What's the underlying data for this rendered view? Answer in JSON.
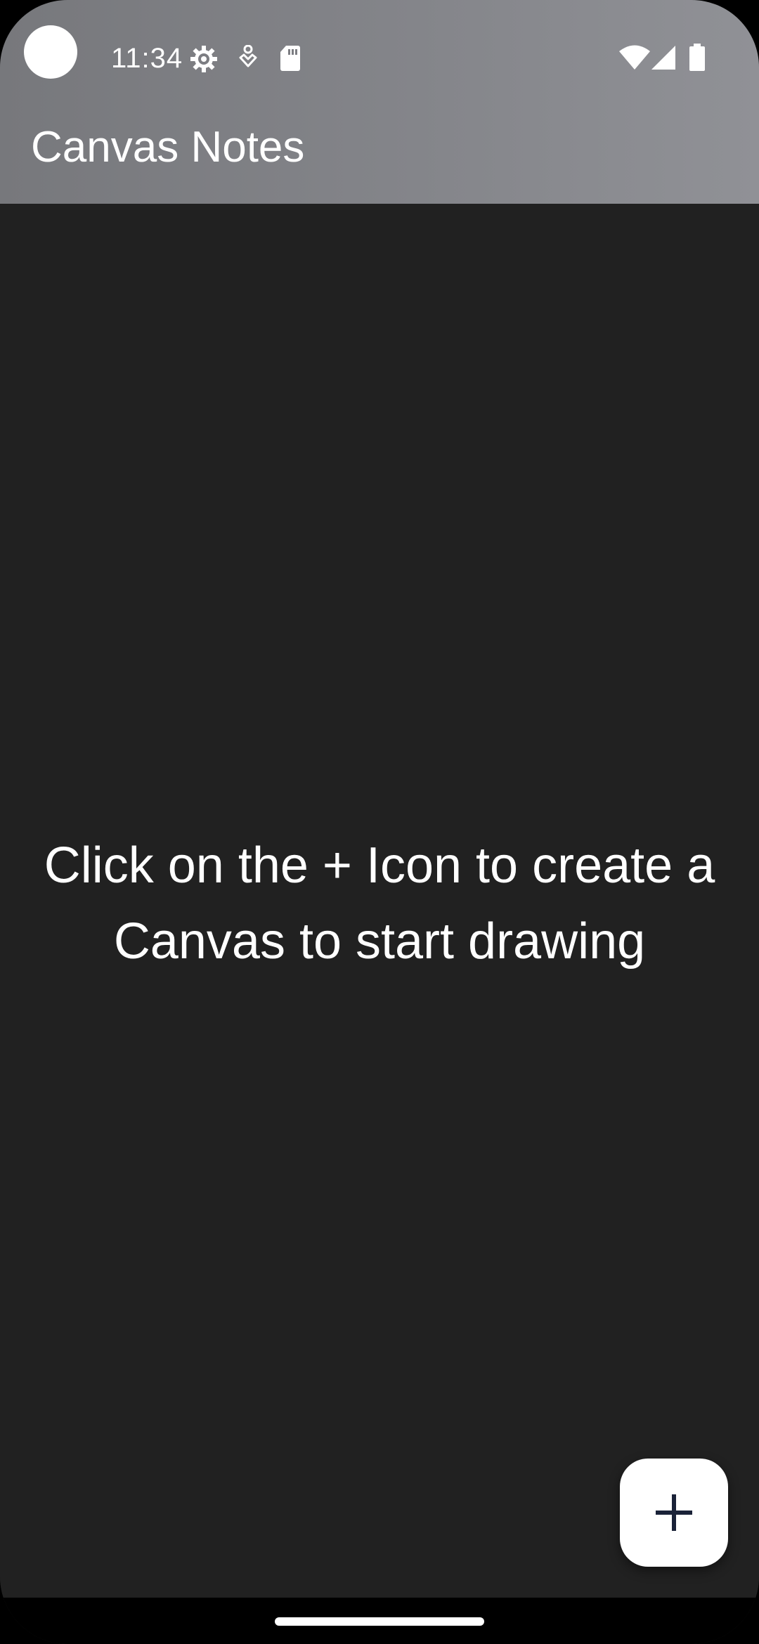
{
  "status_bar": {
    "time": "11:34",
    "icons_left": [
      "gear-icon",
      "accessibility-icon",
      "sd-card-icon"
    ],
    "icons_right": [
      "wifi-icon",
      "cell-signal-icon",
      "battery-icon"
    ]
  },
  "app_bar": {
    "title": "Canvas Notes"
  },
  "main": {
    "empty_message": "Click on the + Icon to create a Canvas to start drawing"
  },
  "fab": {
    "icon": "plus-icon"
  },
  "colors": {
    "app_bar_start": "#77787c",
    "app_bar_end": "#909196",
    "background": "#212121",
    "fab_background": "#ffffff",
    "fab_icon": "#1a2238",
    "text": "#ffffff"
  }
}
